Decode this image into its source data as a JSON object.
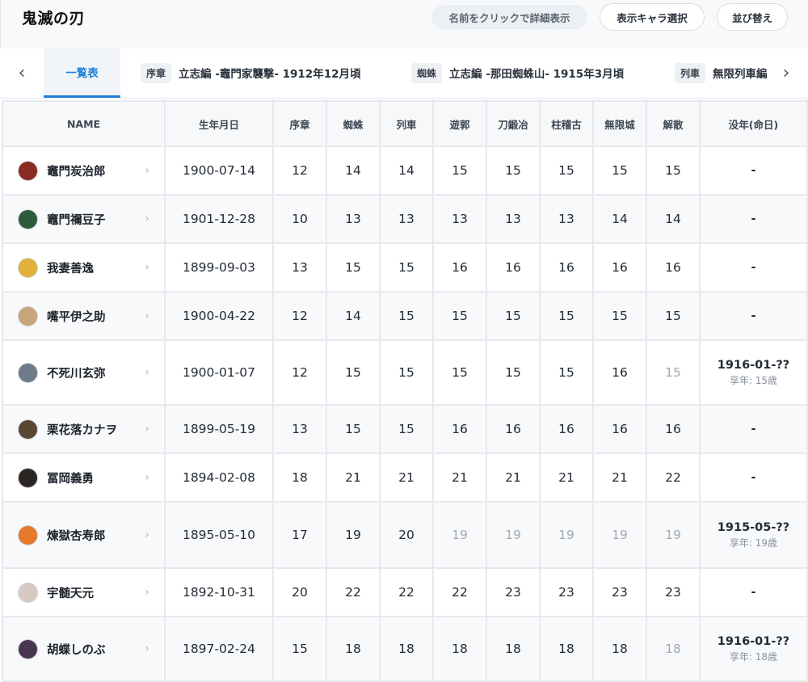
{
  "app": {
    "title": "鬼滅の刃"
  },
  "header": {
    "hint": "名前をクリックで詳細表示",
    "select_button": "表示キャラ選択",
    "sort_button": "並び替え"
  },
  "tabs": {
    "prev_arrow": "‹",
    "next_arrow": "›",
    "active": "一覧表",
    "items": [
      {
        "tag": "序章",
        "label": "立志編 -竈門家襲撃- 1912年12月頃"
      },
      {
        "tag": "蜘蛛",
        "label": "立志編 -那田蜘蛛山- 1915年3月頃"
      },
      {
        "tag": "列車",
        "label": "無限列車編"
      }
    ]
  },
  "table": {
    "columns": [
      "NAME",
      "生年月日",
      "序章",
      "蜘蛛",
      "列車",
      "遊郭",
      "刀鍛冶",
      "柱稽古",
      "無限城",
      "解散",
      "没年(命日)"
    ],
    "rows": [
      {
        "name": "竈門炭治郎",
        "avatar_color": "#8a2a22",
        "birth": "1900-07-14",
        "ages": [
          "12",
          "14",
          "14",
          "15",
          "15",
          "15",
          "15",
          "15"
        ],
        "dim_from": null,
        "death": "-",
        "death_age": ""
      },
      {
        "name": "竈門禰豆子",
        "avatar_color": "#2f5a3a",
        "birth": "1901-12-28",
        "ages": [
          "10",
          "13",
          "13",
          "13",
          "13",
          "13",
          "14",
          "14"
        ],
        "dim_from": null,
        "death": "-",
        "death_age": ""
      },
      {
        "name": "我妻善逸",
        "avatar_color": "#e0b23a",
        "birth": "1899-09-03",
        "ages": [
          "13",
          "15",
          "15",
          "16",
          "16",
          "16",
          "16",
          "16"
        ],
        "dim_from": null,
        "death": "-",
        "death_age": ""
      },
      {
        "name": "嘴平伊之助",
        "avatar_color": "#c9a57a",
        "birth": "1900-04-22",
        "ages": [
          "12",
          "14",
          "15",
          "15",
          "15",
          "15",
          "15",
          "15"
        ],
        "dim_from": null,
        "death": "-",
        "death_age": ""
      },
      {
        "name": "不死川玄弥",
        "avatar_color": "#6d7a8a",
        "birth": "1900-01-07",
        "ages": [
          "12",
          "15",
          "15",
          "15",
          "15",
          "15",
          "16",
          "15"
        ],
        "dim_from": 7,
        "death": "1916-01-??",
        "death_age": "享年: 15歳"
      },
      {
        "name": "栗花落カナヲ",
        "avatar_color": "#5a4632",
        "birth": "1899-05-19",
        "ages": [
          "13",
          "15",
          "15",
          "16",
          "16",
          "16",
          "16",
          "16"
        ],
        "dim_from": null,
        "death": "-",
        "death_age": ""
      },
      {
        "name": "冨岡義勇",
        "avatar_color": "#2b2622",
        "birth": "1894-02-08",
        "ages": [
          "18",
          "21",
          "21",
          "21",
          "21",
          "21",
          "21",
          "22"
        ],
        "dim_from": null,
        "death": "-",
        "death_age": ""
      },
      {
        "name": "煉獄杏寿郎",
        "avatar_color": "#e8792a",
        "birth": "1895-05-10",
        "ages": [
          "17",
          "19",
          "20",
          "19",
          "19",
          "19",
          "19",
          "19"
        ],
        "dim_from": 3,
        "death": "1915-05-??",
        "death_age": "享年: 19歳"
      },
      {
        "name": "宇髄天元",
        "avatar_color": "#d9c9c2",
        "birth": "1892-10-31",
        "ages": [
          "20",
          "22",
          "22",
          "22",
          "23",
          "23",
          "23",
          "23"
        ],
        "dim_from": null,
        "death": "-",
        "death_age": ""
      },
      {
        "name": "胡蝶しのぶ",
        "avatar_color": "#4a3550",
        "birth": "1897-02-24",
        "ages": [
          "15",
          "18",
          "18",
          "18",
          "18",
          "18",
          "18",
          "18"
        ],
        "dim_from": 7,
        "death": "1916-01-??",
        "death_age": "享年: 18歳"
      }
    ]
  }
}
